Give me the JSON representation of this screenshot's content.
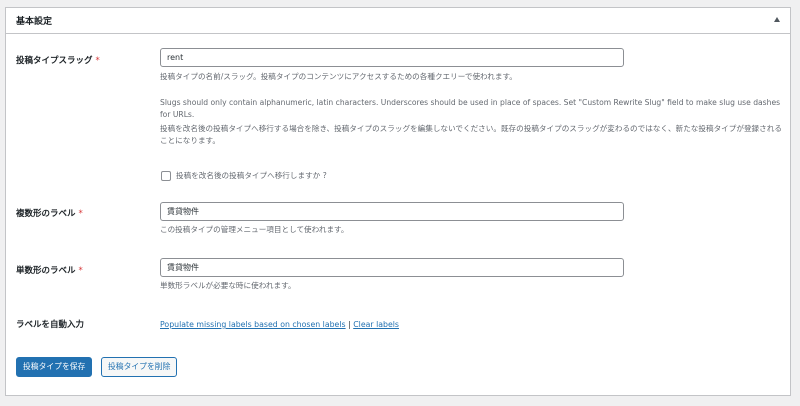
{
  "panel": {
    "title": "基本設定"
  },
  "slug": {
    "label": "投稿タイプスラッグ",
    "required": "*",
    "value": "rent",
    "desc1": "投稿タイプの名前/スラッグ。投稿タイプのコンテンツにアクセスするための各種クエリーで使われます。",
    "desc2": "Slugs should only contain alphanumeric, latin characters. Underscores should be used in place of spaces. Set \"Custom Rewrite Slug\" field to make slug use dashes for URLs.",
    "desc3": "投稿を改名後の投稿タイプへ移行する場合を除き、投稿タイプのスラッグを編集しないでください。既存の投稿タイプのスラッグが変わるのではなく、新たな投稿タイプが登録されることになります。",
    "checkbox_label": "投稿を改名後の投稿タイプへ移行しますか ?"
  },
  "plural": {
    "label": "複数形のラベル",
    "required": "*",
    "value": "賃貸物件",
    "desc": "この投稿タイプの管理メニュー項目として使われます。"
  },
  "singular": {
    "label": "単数形のラベル",
    "required": "*",
    "value": "賃貸物件",
    "desc": "単数形ラベルが必要な時に使われます。"
  },
  "autofill": {
    "label": "ラベルを自動入力",
    "populate_link": "Populate missing labels based on chosen labels",
    "separator": "|",
    "clear_link": "Clear labels"
  },
  "buttons": {
    "save": "投稿タイプを保存",
    "delete": "投稿タイプを削除"
  },
  "colors": {
    "primary": "#2271b1",
    "required": "#d63638"
  }
}
